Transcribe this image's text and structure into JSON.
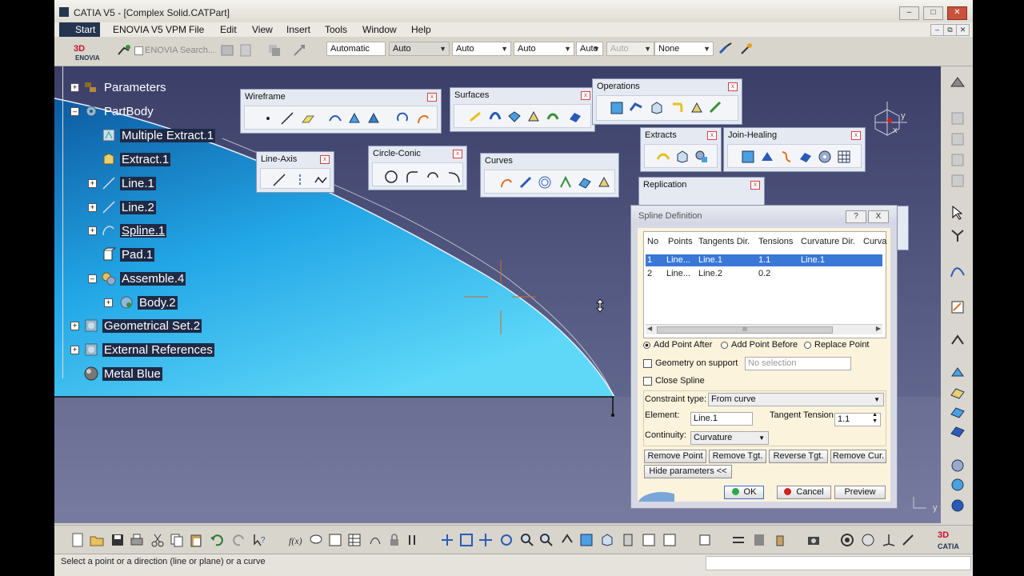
{
  "window": {
    "title": "CATIA V5 - [Complex Solid.CATPart]"
  },
  "menu": [
    "Start",
    "ENOVIA V5 VPM",
    "File",
    "Edit",
    "View",
    "Insert",
    "Tools",
    "Window",
    "Help"
  ],
  "toolbar": {
    "search_placeholder": "ENOVIA Search...",
    "combos": [
      "Automatic",
      "Auto",
      "Auto",
      "Auto",
      "Auto",
      "Auto",
      "None"
    ]
  },
  "tree": [
    {
      "label": "Parameters",
      "icon": "parameters-icon"
    },
    {
      "label": "PartBody",
      "icon": "gear-icon"
    },
    {
      "label": "Multiple Extract.1",
      "icon": "extract-icon"
    },
    {
      "label": "Extract.1",
      "icon": "extract-icon"
    },
    {
      "label": "Line.1",
      "icon": "line-icon"
    },
    {
      "label": "Line.2",
      "icon": "line-icon"
    },
    {
      "label": "Spline.1",
      "icon": "spline-icon"
    },
    {
      "label": "Pad.1",
      "icon": "pad-icon"
    },
    {
      "label": "Assemble.4",
      "icon": "assemble-icon"
    },
    {
      "label": "Body.2",
      "icon": "body-icon"
    },
    {
      "label": "Geometrical Set.2",
      "icon": "geometrical-set-icon"
    },
    {
      "label": "External References",
      "icon": "external-references-icon"
    },
    {
      "label": "Metal Blue",
      "icon": "material-sphere-icon"
    }
  ],
  "toolbars": {
    "wireframe": "Wireframe",
    "line_axis": "Line-Axis",
    "circle_conic": "Circle-Conic",
    "surfaces": "Surfaces",
    "curves": "Curves",
    "operations": "Operations",
    "extracts": "Extracts",
    "join_healing": "Join-Healing",
    "replication": "Replication"
  },
  "compass": {
    "y_label": "y",
    "x_label": "x",
    "bottom_label": "y"
  },
  "dialog": {
    "title": "Spline Definition",
    "help_btn": "?",
    "close_btn": "X",
    "columns": [
      "No",
      "Points",
      "Tangents Dir.",
      "Tensions",
      "Curvature Dir.",
      "Curva"
    ],
    "rows": [
      {
        "no": "1",
        "points": "Line...",
        "tangent": "Line.1",
        "tension": "1.1",
        "curvature": "Line.1"
      },
      {
        "no": "2",
        "points": "Line...",
        "tangent": "Line.2",
        "tension": "0.2",
        "curvature": ""
      }
    ],
    "scroll_thumb": "III",
    "radio_options": [
      "Add Point After",
      "Add Point Before",
      "Replace Point"
    ],
    "selected_radio": "Add Point After",
    "geometry_on_support": "Geometry on support",
    "support_value": "No selection",
    "close_spline": "Close Spline",
    "constraint_type_label": "Constraint type:",
    "constraint_type_value": "From curve",
    "element_label": "Element:",
    "element_value": "Line.1",
    "tangent_tension_label": "Tangent Tension",
    "tangent_tension_value": "1.1",
    "continuity_label": "Continuity:",
    "continuity_value": "Curvature",
    "buttons": [
      "Remove Point",
      "Remove Tgt.",
      "Reverse Tgt.",
      "Remove Cur."
    ],
    "hide_parameters": "Hide parameters <<",
    "ok": "OK",
    "cancel": "Cancel",
    "preview": "Preview"
  },
  "status": {
    "text": "Select a point or a direction (line or plane) or a curve"
  },
  "colors": {
    "accent": "#3a78d8",
    "viewport_top": "#3b3f68",
    "surface": "#1a9ad8",
    "title_bg": "#24354f"
  }
}
